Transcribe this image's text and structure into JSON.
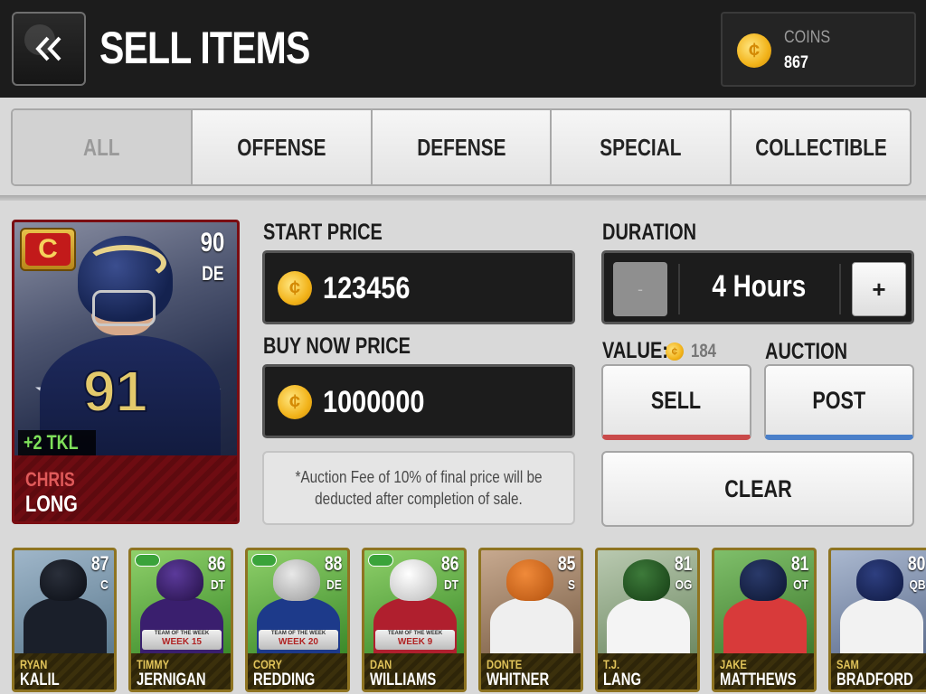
{
  "header": {
    "title": "SELL ITEMS",
    "coins_label": "COINS",
    "coins_value": "867",
    "back_icon": "double-chevron-left-icon",
    "coin_icon": "coin-icon"
  },
  "tabs": [
    {
      "label": "ALL",
      "active": true
    },
    {
      "label": "OFFENSE",
      "active": false
    },
    {
      "label": "DEFENSE",
      "active": false
    },
    {
      "label": "SPECIAL",
      "active": false
    },
    {
      "label": "COLLECTIBLE",
      "active": false
    }
  ],
  "selected_card": {
    "rating": "90",
    "position": "DE",
    "badge": "C",
    "jersey_number": "91",
    "boost": "+2 TKL",
    "first_name": "CHRIS",
    "last_name": "LONG"
  },
  "form": {
    "start_price_label": "START PRICE",
    "start_price_value": "123456",
    "buy_now_label": "BUY NOW PRICE",
    "buy_now_value": "1000000",
    "fee_note": "*Auction Fee of 10% of final price will be deducted after completion of sale.",
    "duration_label": "DURATION",
    "duration_value": "4 Hours",
    "minus_label": "-",
    "plus_label": "+",
    "value_label": "VALUE:",
    "value_amount": "184",
    "auction_label": "AUCTION",
    "sell_button": "SELL",
    "post_button": "POST",
    "clear_button": "CLEAR"
  },
  "card_strip": [
    {
      "first": "RYAN",
      "last": "KALIL",
      "rating": "87",
      "pos": "C",
      "totw": false,
      "week": ""
    },
    {
      "first": "TIMMY",
      "last": "JERNIGAN",
      "rating": "86",
      "pos": "DT",
      "totw": true,
      "week": "WEEK 15"
    },
    {
      "first": "CORY",
      "last": "REDDING",
      "rating": "88",
      "pos": "DE",
      "totw": true,
      "week": "WEEK 20"
    },
    {
      "first": "DAN",
      "last": "WILLIAMS",
      "rating": "86",
      "pos": "DT",
      "totw": true,
      "week": "WEEK 9"
    },
    {
      "first": "DONTE",
      "last": "WHITNER",
      "rating": "85",
      "pos": "S",
      "totw": false,
      "week": ""
    },
    {
      "first": "T.J.",
      "last": "LANG",
      "rating": "81",
      "pos": "OG",
      "totw": false,
      "week": ""
    },
    {
      "first": "JAKE",
      "last": "MATTHEWS",
      "rating": "81",
      "pos": "OT",
      "totw": false,
      "week": ""
    },
    {
      "first": "SAM",
      "last": "BRADFORD",
      "rating": "80",
      "pos": "QB",
      "totw": false,
      "week": ""
    }
  ],
  "banner_text": "TEAM OF THE WEEK",
  "colors": {
    "accent_sell": "#c94a4a",
    "accent_post": "#4a7fc9",
    "card_red": "#7a0d12",
    "card_gold": "#8e7422",
    "coin_gold": "#f2b31a"
  }
}
